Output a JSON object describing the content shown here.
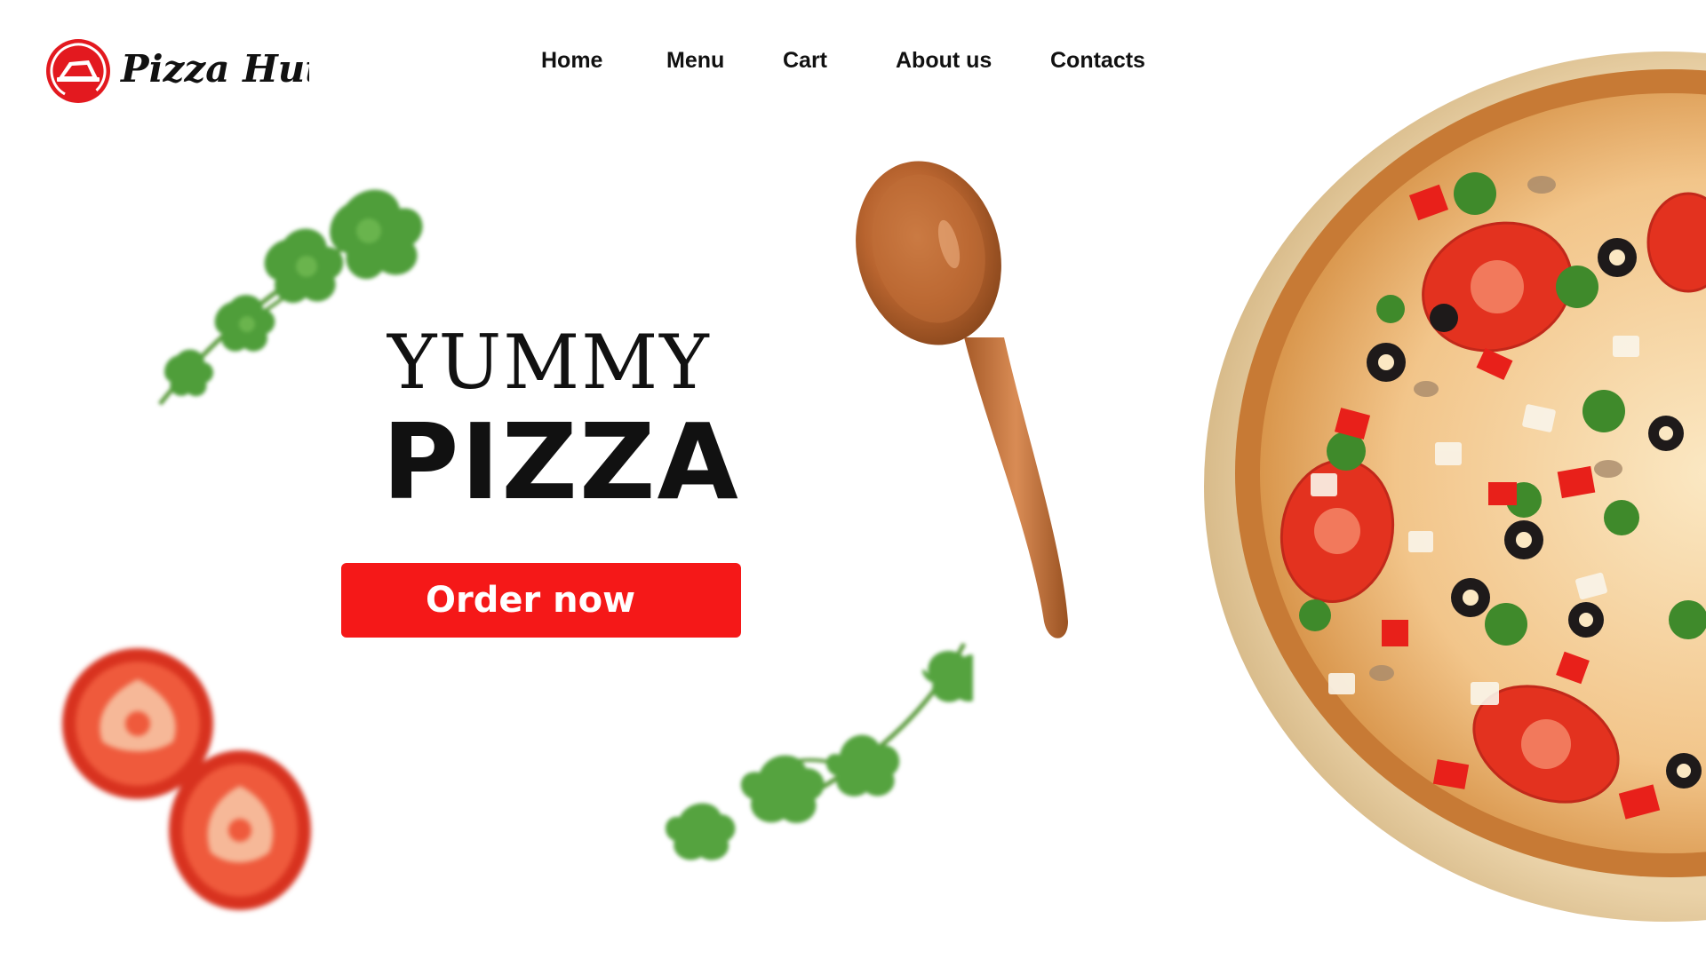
{
  "brand": {
    "name": "Pizza Hut",
    "primary_color": "#e3191f",
    "button_color": "#f51818",
    "text_color": "#111111"
  },
  "nav": {
    "items": [
      {
        "label": "Home"
      },
      {
        "label": "Menu"
      },
      {
        "label": "Cart"
      },
      {
        "label": "About us"
      },
      {
        "label": "Contacts"
      }
    ]
  },
  "hero": {
    "line1": "YUMMY",
    "line2": "PIZZA",
    "cta_label": "Order now"
  },
  "decorations": {
    "items": [
      "cilantro-sprig-icon",
      "tomato-slice-icon",
      "wooden-spoon-icon",
      "pizza-icon",
      "cilantro-sprig-icon"
    ]
  }
}
